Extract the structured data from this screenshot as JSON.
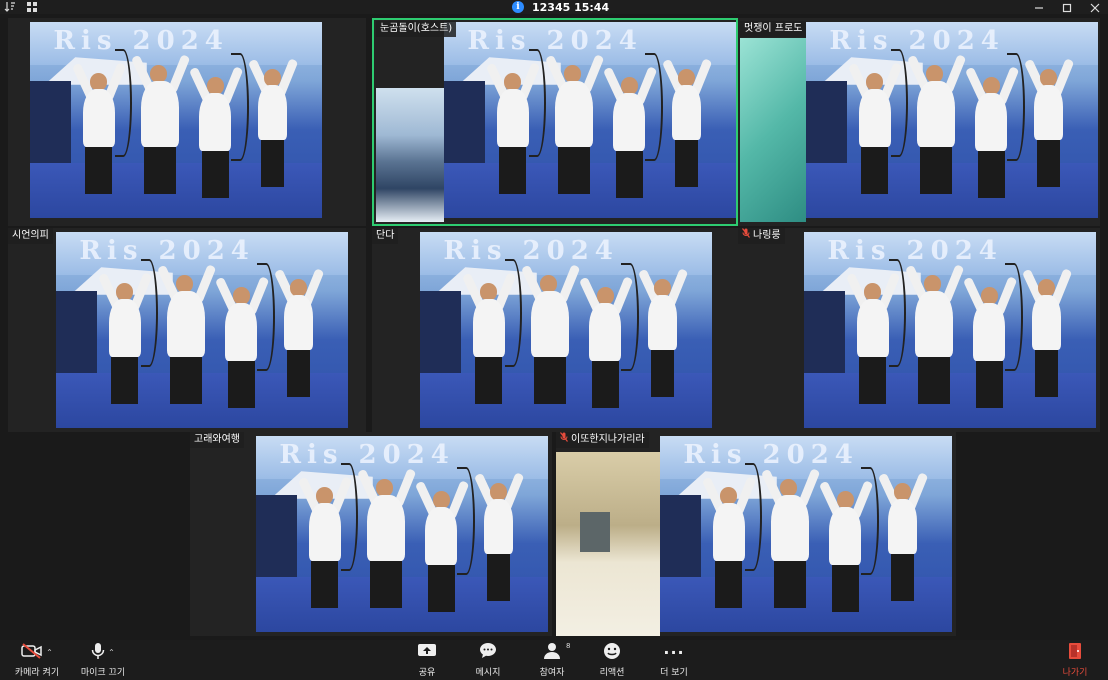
{
  "titlebar": {
    "meeting_title": "12345 15:44",
    "info_icon": "i",
    "min_icon": "minimize-icon",
    "max_icon": "maximize-icon",
    "close_icon": "close-icon"
  },
  "participants": [
    {
      "name": "",
      "muted": false,
      "bg": "photo"
    },
    {
      "name": "눈곰돌이(호스트)",
      "muted": false,
      "bg": "mountain",
      "speaking": true
    },
    {
      "name": "멋쟁이 프로도",
      "muted": false,
      "bg": "teal"
    },
    {
      "name": "시언의피",
      "muted": false,
      "bg": "photo"
    },
    {
      "name": "단다",
      "muted": false,
      "bg": "photo"
    },
    {
      "name": "나링룽",
      "muted": true,
      "bg": "photo"
    },
    {
      "name": "고래와여행",
      "muted": false,
      "bg": "photo"
    },
    {
      "name": "이또한지나가리라",
      "muted": true,
      "bg": "hall"
    }
  ],
  "photo_sign_text": "Ris 2024",
  "toolbar": {
    "camera": {
      "label": "카메라 켜기",
      "caret": "⌃"
    },
    "mic": {
      "label": "마이크 끄기",
      "caret": "⌃"
    },
    "share": {
      "label": "공유"
    },
    "chat": {
      "label": "메시지"
    },
    "participants": {
      "label": "참여자",
      "count": "8"
    },
    "reactions": {
      "label": "리액션"
    },
    "more": {
      "label": "더 보기",
      "glyph": "···"
    },
    "leave": {
      "label": "나가기"
    }
  },
  "colors": {
    "accent": "#2d8cff",
    "speaker_border": "#2ecc71",
    "leave": "#e74c3c"
  }
}
